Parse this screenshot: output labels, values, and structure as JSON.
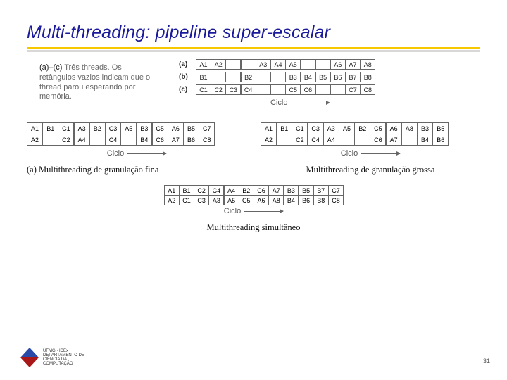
{
  "title": "Multi-threading: pipeline super-escalar",
  "intro": {
    "lead": "(a)–(c)",
    "rest": " Três threads. Os retângulos vazios indicam que o thread parou esperando por memória."
  },
  "threads": {
    "a": {
      "label": "(a)",
      "cells": [
        "A1",
        "A2",
        "",
        "",
        "A3",
        "A4",
        "A5",
        "",
        "",
        "A6",
        "A7",
        "A8"
      ]
    },
    "b": {
      "label": "(b)",
      "cells": [
        "B1",
        "",
        "",
        "B2",
        "",
        "",
        "B3",
        "B4",
        "B5",
        "B6",
        "B7",
        "B8"
      ]
    },
    "c": {
      "label": "(c)",
      "cells": [
        "C1",
        "C2",
        "C3",
        "C4",
        "",
        "",
        "C5",
        "C6",
        "",
        "",
        "C7",
        "C8"
      ]
    }
  },
  "ciclo_label": "Ciclo",
  "panels": {
    "left": {
      "row1": [
        "A1",
        "B1",
        "C1",
        "A3",
        "B2",
        "C3",
        "A5",
        "B3",
        "C5",
        "A6",
        "B5",
        "C7"
      ],
      "row2": [
        "A2",
        "",
        "C2",
        "A4",
        "",
        "C4",
        "",
        "B4",
        "C6",
        "A7",
        "B6",
        "C8"
      ],
      "caption": "(a) Multithreading de granulação fina"
    },
    "right": {
      "row1": [
        "A1",
        "B1",
        "C1",
        "C3",
        "A3",
        "A5",
        "B2",
        "C5",
        "A6",
        "A8",
        "B3",
        "B5"
      ],
      "row2": [
        "A2",
        "",
        "C2",
        "C4",
        "A4",
        "",
        "",
        "C6",
        "A7",
        "",
        "B4",
        "B6"
      ],
      "caption": "Multithreading de granulação grossa"
    },
    "bottom": {
      "row1": [
        "A1",
        "B1",
        "C2",
        "C4",
        "A4",
        "B2",
        "C6",
        "A7",
        "B3",
        "B5",
        "B7",
        "C7"
      ],
      "row2": [
        "A2",
        "C1",
        "C3",
        "A3",
        "A5",
        "C5",
        "A6",
        "A8",
        "B4",
        "B6",
        "B8",
        "C8"
      ],
      "caption": "Multithreading simultâneo"
    }
  },
  "page_number": "31"
}
